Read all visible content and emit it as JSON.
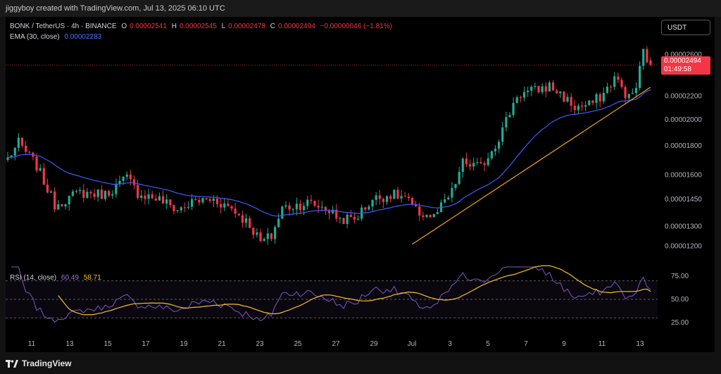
{
  "header": {
    "credit": "jiggyboy created with TradingView.com, Jul 13, 2025 06:10 UTC"
  },
  "legend": {
    "symbol": "BONK / TetherUS · 4h · BINANCE",
    "open_label": "O",
    "open": "0.00002541",
    "high_label": "H",
    "high": "0.00002545",
    "low_label": "L",
    "low": "0.00002478",
    "close_label": "C",
    "close": "0.00002494",
    "change": "−0.00000046 (−1.81%)",
    "ema_label": "EMA (30, close)",
    "ema_value": "0.00002283",
    "rsi_label": "RSI (14, close)",
    "rsi_value": "60.49",
    "rsi_ma_value": "58.71"
  },
  "price_axis": {
    "currency": "USDT",
    "last_price": "0.00002494",
    "countdown": "01:49:58"
  },
  "footer": {
    "brand": "TradingView"
  },
  "colors": {
    "up": "#22ab94",
    "down": "#f23645",
    "ema": "#3d5afe",
    "trend": "#f7a21b",
    "rsi": "#7e57c2",
    "rsi_ma": "#f5c022"
  },
  "chart_data": [
    {
      "type": "candlestick",
      "title": "BONK / TetherUS · 4h · BINANCE",
      "x_ticks": [
        "11",
        "13",
        "15",
        "17",
        "19",
        "21",
        "23",
        "25",
        "27",
        "29",
        "Jul",
        "3",
        "5",
        "7",
        "9",
        "11",
        "13"
      ],
      "y_ticks": [
        "0.00002600",
        "0.00002200",
        "0.00002000",
        "0.00001800",
        "0.00001600",
        "0.00001450",
        "0.00001300",
        "0.00001200"
      ],
      "y_tick_values": [
        2.6e-05,
        2.2e-05,
        2e-05,
        1.8e-05,
        1.6e-05,
        1.45e-05,
        1.3e-05,
        1.2e-05
      ],
      "y_scale": "log",
      "ylim": [
        1.12e-05,
        2.78e-05
      ],
      "grid": false,
      "close_path": [
        [
          0,
          1.71e-05
        ],
        [
          3,
          1.82e-05
        ],
        [
          8,
          1.66e-05
        ],
        [
          13,
          1.42e-05
        ],
        [
          20,
          1.49e-05
        ],
        [
          27,
          1.48e-05
        ],
        [
          33,
          1.58e-05
        ],
        [
          36,
          1.49e-05
        ],
        [
          42,
          1.45e-05
        ],
        [
          47,
          1.39e-05
        ],
        [
          52,
          1.44e-05
        ],
        [
          57,
          1.45e-05
        ],
        [
          62,
          1.4e-05
        ],
        [
          67,
          1.31e-05
        ],
        [
          70,
          1.22e-05
        ],
        [
          73,
          1.25e-05
        ],
        [
          76,
          1.4e-05
        ],
        [
          83,
          1.43e-05
        ],
        [
          88,
          1.4e-05
        ],
        [
          92,
          1.34e-05
        ],
        [
          96,
          1.34e-05
        ],
        [
          101,
          1.45e-05
        ],
        [
          106,
          1.48e-05
        ],
        [
          110,
          1.46e-05
        ],
        [
          113,
          1.38e-05
        ],
        [
          118,
          1.35e-05
        ],
        [
          123,
          1.49e-05
        ],
        [
          126,
          1.68e-05
        ],
        [
          131,
          1.65e-05
        ],
        [
          136,
          1.86e-05
        ],
        [
          141,
          2.21e-05
        ],
        [
          146,
          2.25e-05
        ],
        [
          150,
          2.29e-05
        ],
        [
          153,
          2.22e-05
        ],
        [
          157,
          2.1e-05
        ],
        [
          161,
          2.12e-05
        ],
        [
          165,
          2.22e-05
        ],
        [
          168,
          2.37e-05
        ],
        [
          172,
          2.18e-05
        ],
        [
          174,
          2.28e-05
        ],
        [
          176,
          2.63e-05
        ],
        [
          178,
          2.49e-05
        ]
      ],
      "ema": {
        "name": "EMA (30, close)",
        "last": 2.283e-05
      },
      "trendline": [
        [
          112,
          1.21e-05
        ],
        [
          178,
          2.28e-05
        ]
      ],
      "last_price": 2.494e-05
    },
    {
      "type": "line",
      "title": "RSI (14, close)",
      "ylim": [
        15,
        85
      ],
      "y_ticks": [
        75,
        50,
        25
      ],
      "bands": [
        30,
        70
      ],
      "series": [
        {
          "name": "RSI (14, close)",
          "last": 60.49
        },
        {
          "name": "RSI MA",
          "last": 58.71
        }
      ]
    }
  ]
}
